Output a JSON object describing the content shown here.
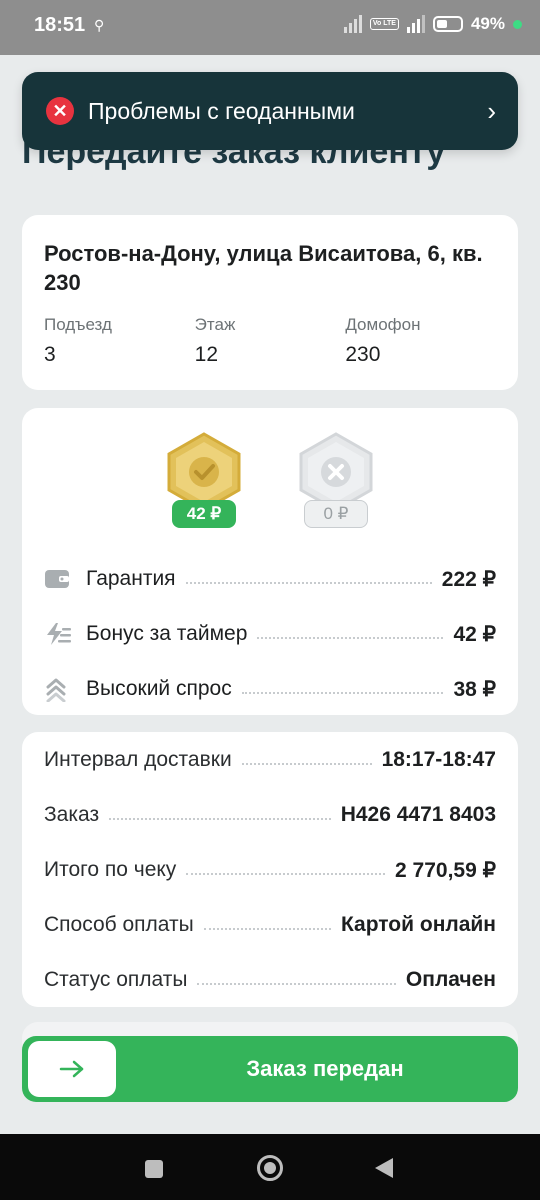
{
  "status_bar": {
    "time": "18:51",
    "battery": "49%",
    "volte": "Vo LTE"
  },
  "page": {
    "title": "Передайте заказ клиенту"
  },
  "toast": {
    "text": "Проблемы с геоданными",
    "icon": "error-x-icon"
  },
  "address": {
    "line": "Ростов-на-Дону, улица Висаитова, 6, кв. 230",
    "fields": [
      {
        "label": "Подъезд",
        "value": "3"
      },
      {
        "label": "Этаж",
        "value": "12"
      },
      {
        "label": "Домофон",
        "value": "230"
      }
    ]
  },
  "bonus": {
    "badges": [
      {
        "amount": "42 ₽",
        "state": "earned"
      },
      {
        "amount": "0 ₽",
        "state": "missed"
      }
    ],
    "rows": [
      {
        "icon": "wallet-icon",
        "label": "Гарантия",
        "value": "222 ₽"
      },
      {
        "icon": "lightning-timer-icon",
        "label": "Бонус за таймер",
        "value": "42 ₽"
      },
      {
        "icon": "double-chevron-up-icon",
        "label": "Высокий спрос",
        "value": "38 ₽"
      }
    ]
  },
  "details": {
    "rows": [
      {
        "label": "Интервал доставки",
        "value": "18:17-18:47"
      },
      {
        "label": "Заказ",
        "value": "Н426 4471 8403"
      },
      {
        "label": "Итого по чеку",
        "value": "2 770,59 ₽"
      },
      {
        "label": "Способ оплаты",
        "value": "Картой онлайн"
      },
      {
        "label": "Статус оплаты",
        "value": "Оплачен"
      }
    ]
  },
  "cta": {
    "label": "Заказ передан"
  },
  "colors": {
    "accent_green": "#34b45a",
    "toast_bg": "#17343a",
    "error_red": "#e8333f"
  }
}
